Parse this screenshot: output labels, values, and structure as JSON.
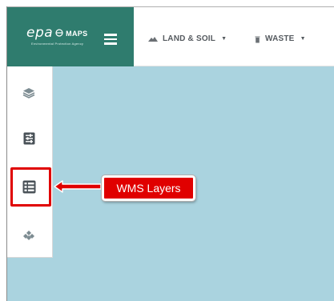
{
  "header": {
    "logo_text": "epa",
    "logo_maps": "MAPS",
    "logo_subtitle": "Environmental Protection Agency",
    "nav": [
      {
        "label": "LAND & SOIL",
        "icon": "land-soil-icon"
      },
      {
        "label": "WASTE",
        "icon": "waste-bin-icon"
      }
    ]
  },
  "sidebar": {
    "items": [
      {
        "name": "layers",
        "icon": "layers-icon"
      },
      {
        "name": "filters",
        "icon": "sliders-icon"
      },
      {
        "name": "wms-layers",
        "icon": "database-list-icon"
      },
      {
        "name": "base-maps",
        "icon": "diamond-grid-icon"
      }
    ]
  },
  "annotation": {
    "label": "WMS Layers"
  },
  "colors": {
    "header_green": "#2f7c6e",
    "map_water": "#aad3df",
    "annotation_red": "#e00000",
    "nav_text": "#555a5f"
  }
}
